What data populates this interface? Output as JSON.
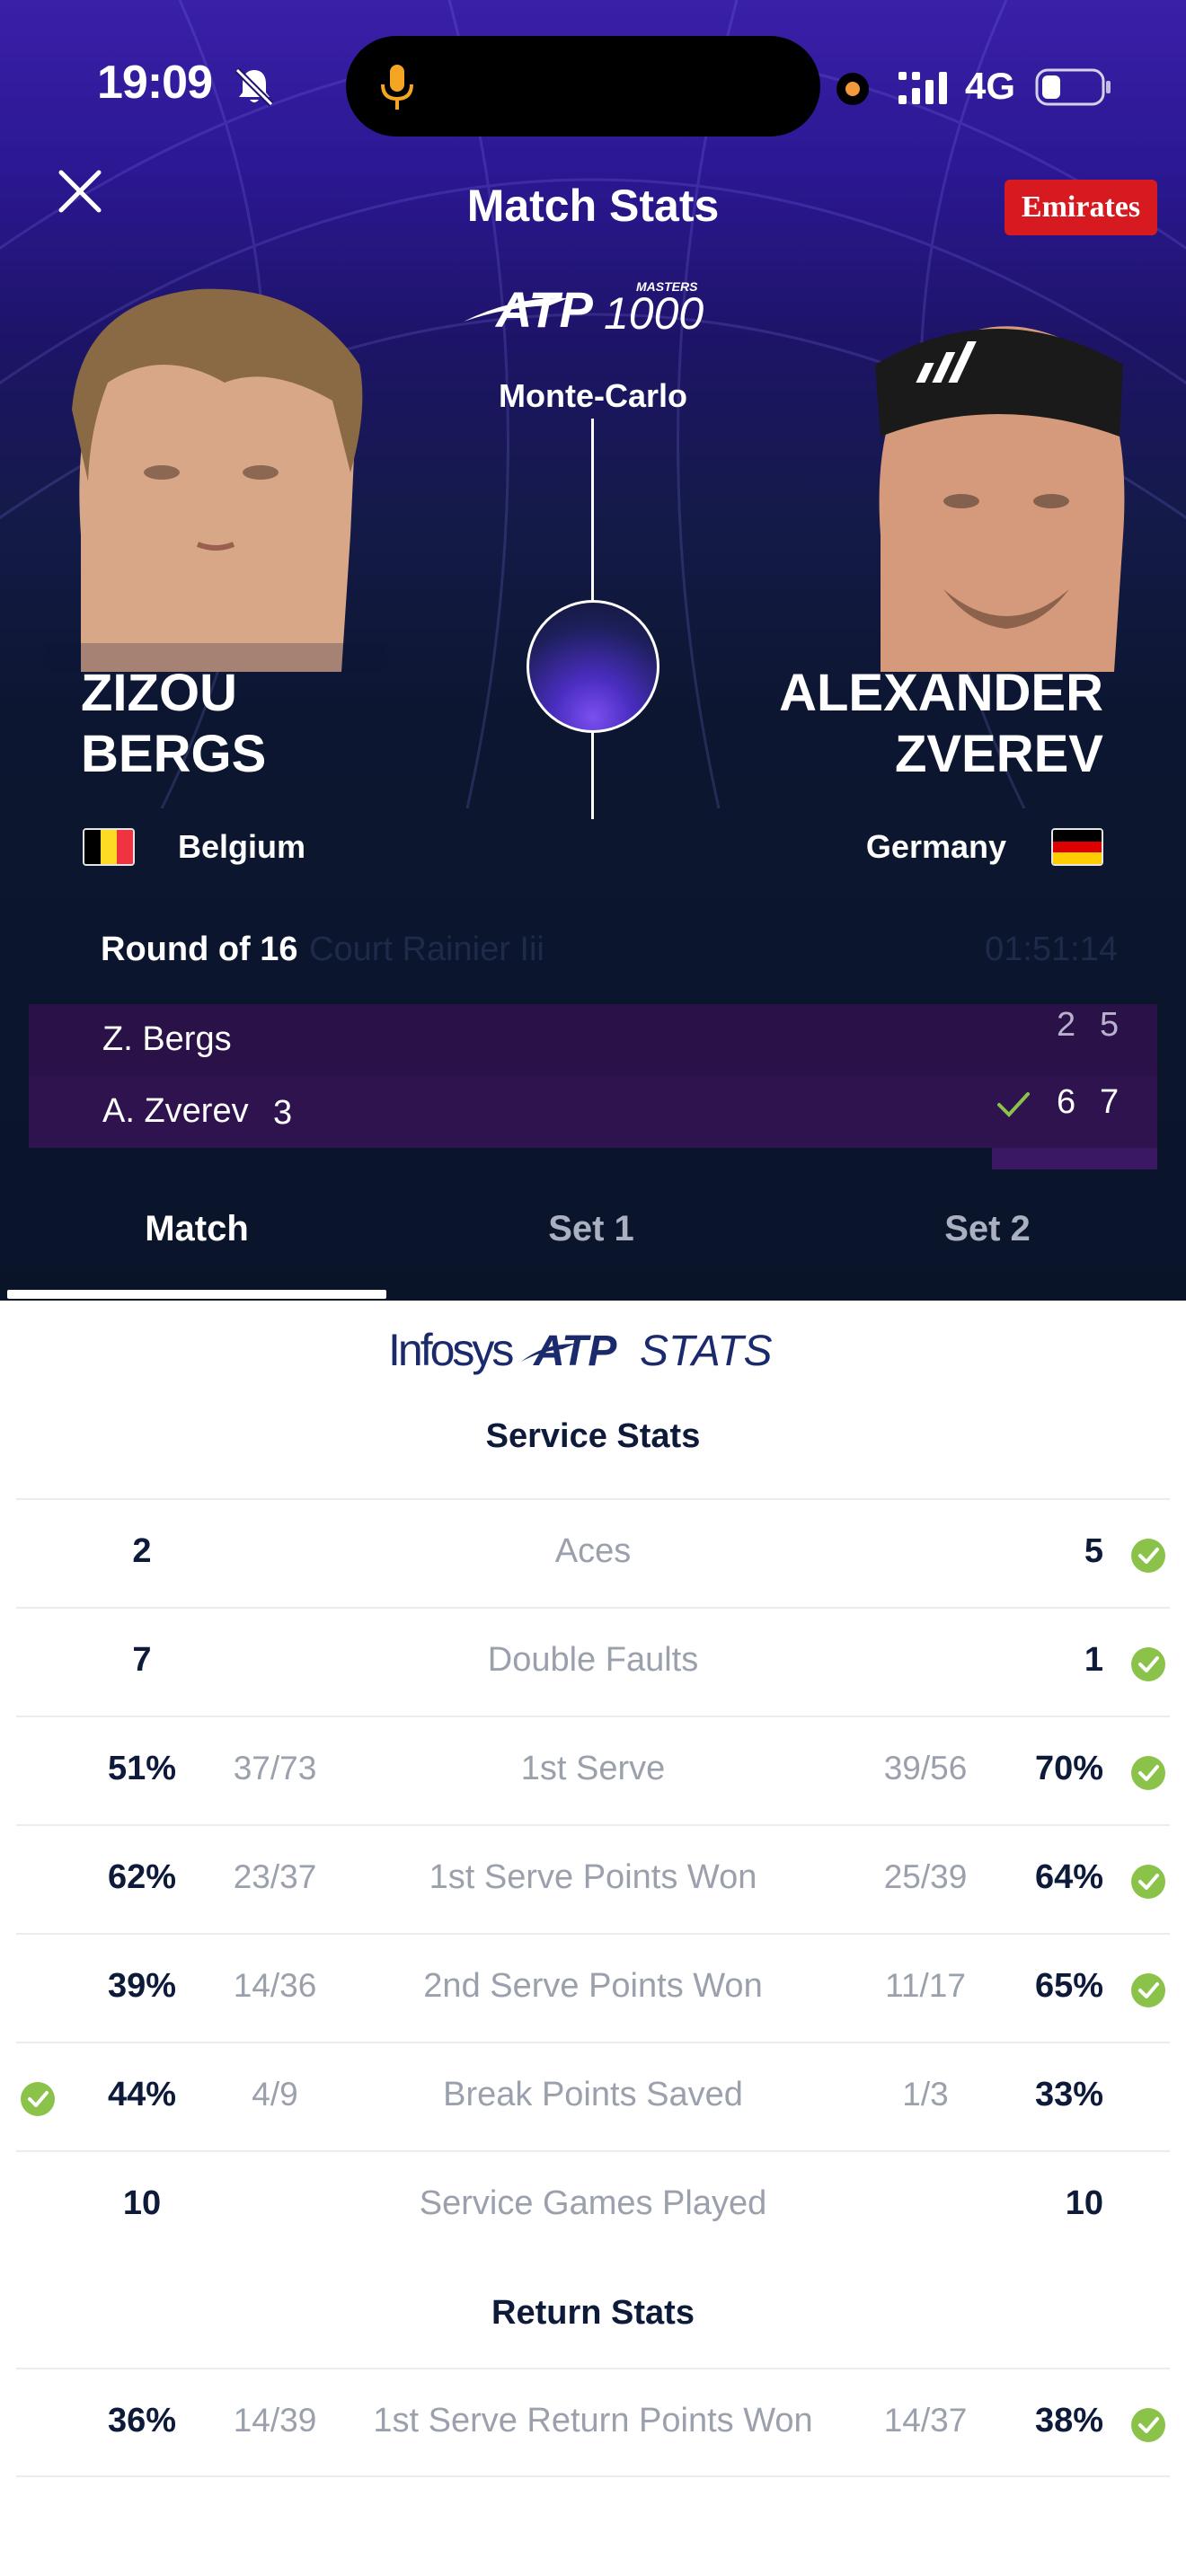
{
  "status_bar": {
    "time": "19:09",
    "network": "4G"
  },
  "header": {
    "title": "Match Stats",
    "sponsor": "Emirates",
    "tournament": "Monte-Carlo",
    "atp_logo_text": "ATP",
    "atp_logo_small": "MASTERS",
    "atp_logo_number": "1000"
  },
  "players": {
    "left": {
      "first": "ZIZOU",
      "last": "BERGS",
      "country": "Belgium"
    },
    "right": {
      "first": "ALEXANDER",
      "last": "ZVEREV",
      "country": "Germany"
    }
  },
  "match_info": {
    "round": "Round of 16",
    "court": "Court Rainier Iii",
    "duration": "01:51:14"
  },
  "scoreboard": [
    {
      "name": "Z. Bergs",
      "seed": "",
      "sets": [
        "2",
        "5"
      ],
      "winner": false
    },
    {
      "name": "A. Zverev",
      "seed": "3",
      "sets": [
        "6",
        "7"
      ],
      "winner": true
    }
  ],
  "tabs": [
    {
      "label": "Match",
      "active": true
    },
    {
      "label": "Set 1",
      "active": false
    },
    {
      "label": "Set 2",
      "active": false
    }
  ],
  "stats_logo": {
    "brand": "Infosys",
    "atp": "ATP",
    "stats": "STATS"
  },
  "service_stats": {
    "title": "Service Stats",
    "rows": [
      {
        "label": "Aces",
        "p1": "2",
        "p1_frac": "",
        "p2": "5",
        "p2_frac": "",
        "winner": "p2"
      },
      {
        "label": "Double Faults",
        "p1": "7",
        "p1_frac": "",
        "p2": "1",
        "p2_frac": "",
        "winner": "p2"
      },
      {
        "label": "1st Serve",
        "p1": "51%",
        "p1_frac": "37/73",
        "p2": "70%",
        "p2_frac": "39/56",
        "winner": "p2"
      },
      {
        "label": "1st Serve Points Won",
        "p1": "62%",
        "p1_frac": "23/37",
        "p2": "64%",
        "p2_frac": "25/39",
        "winner": "p2"
      },
      {
        "label": "2nd Serve Points Won",
        "p1": "39%",
        "p1_frac": "14/36",
        "p2": "65%",
        "p2_frac": "11/17",
        "winner": "p2"
      },
      {
        "label": "Break Points Saved",
        "p1": "44%",
        "p1_frac": "4/9",
        "p2": "33%",
        "p2_frac": "1/3",
        "winner": "p1"
      },
      {
        "label": "Service Games Played",
        "p1": "10",
        "p1_frac": "",
        "p2": "10",
        "p2_frac": "",
        "winner": ""
      }
    ]
  },
  "return_stats": {
    "title": "Return Stats",
    "rows": [
      {
        "label": "1st Serve Return Points Won",
        "p1": "36%",
        "p1_frac": "14/39",
        "p2": "38%",
        "p2_frac": "14/37",
        "winner": "p2"
      }
    ]
  },
  "colors": {
    "header_top": "#3a1fa8",
    "header_bottom": "#0a1429",
    "score_row": "#2a1248",
    "check_green": "#8bc34a",
    "sponsor_red": "#d71920",
    "text_dark": "#0e1a3a",
    "text_muted": "#9aa0ac"
  },
  "icons": [
    "close-icon",
    "bell-slash-icon",
    "mic-icon",
    "signal-icon",
    "battery-icon",
    "check-icon",
    "belgium-flag-icon",
    "germany-flag-icon"
  ]
}
